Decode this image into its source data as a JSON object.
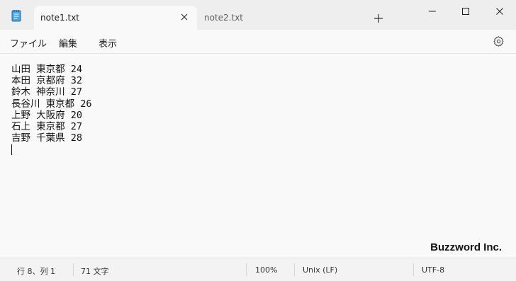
{
  "tabs": [
    {
      "label": "note1.txt",
      "active": true
    },
    {
      "label": "note2.txt",
      "active": false
    }
  ],
  "menu": [
    "ファイル",
    "編集",
    "表示"
  ],
  "editor": {
    "lines": [
      "山田 東京都 24",
      "本田 京都府 32",
      "鈴木 神奈川 27",
      "長谷川 東京都 26",
      "上野 大阪府 20",
      "石上 東京都 27",
      "吉野 千葉県 28"
    ]
  },
  "watermark": "Buzzword Inc.",
  "status": {
    "position": "行 8、列 1",
    "chars": "71 文字",
    "zoom": "100%",
    "line_ending": "Unix (LF)",
    "encoding": "UTF-8"
  },
  "icons": {
    "app": "notepad-icon",
    "close_tab": "close-icon",
    "new_tab": "plus-icon",
    "minimize": "minimize-icon",
    "maximize": "maximize-icon",
    "close_window": "close-icon",
    "settings": "gear-icon"
  },
  "colors": {
    "accent": "#0078d4",
    "titlebar": "#eeeeee",
    "editor_bg": "#f9f9f9"
  }
}
